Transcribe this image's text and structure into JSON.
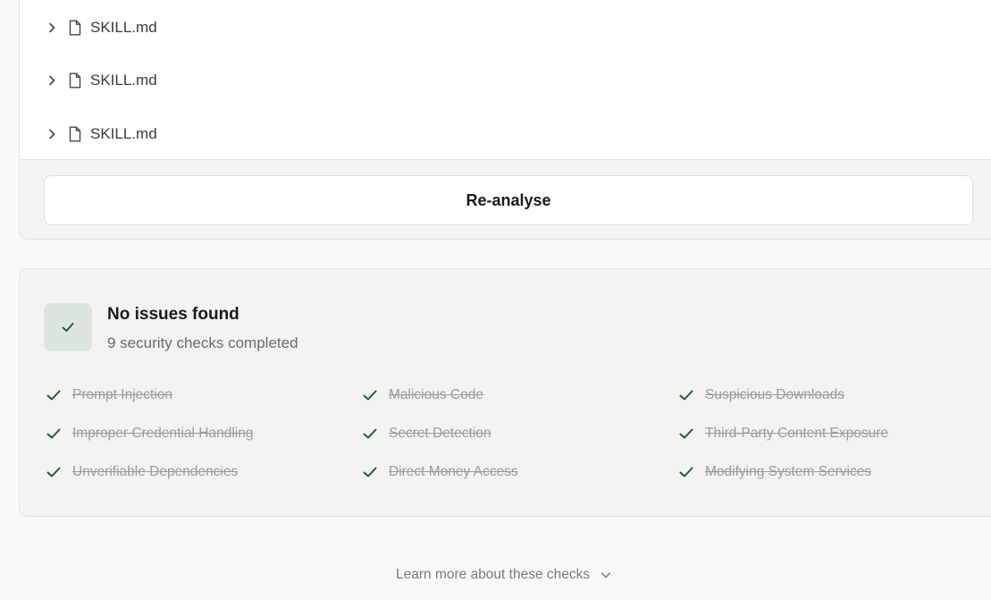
{
  "files": [
    {
      "name": "SKILL.md"
    },
    {
      "name": "SKILL.md"
    },
    {
      "name": "SKILL.md"
    }
  ],
  "reanalyse_label": "Re-analyse",
  "result": {
    "title": "No issues found",
    "subtitle": "9 security checks completed",
    "accent_color": "#1e5a3a",
    "checks": [
      {
        "label": "Prompt Injection"
      },
      {
        "label": "Malicious Code"
      },
      {
        "label": "Suspicious Downloads"
      },
      {
        "label": "Improper Credential Handling"
      },
      {
        "label": "Secret Detection"
      },
      {
        "label": "Third-Party Content Exposure"
      },
      {
        "label": "Unverifiable Dependencies"
      },
      {
        "label": "Direct Money Access"
      },
      {
        "label": "Modifying System Services"
      }
    ]
  },
  "learn_more_label": "Learn more about these checks",
  "icons": {
    "file_expand": "chevron-right-icon",
    "file": "document-icon",
    "status": "check-icon",
    "learn_more": "chevron-down-icon"
  }
}
